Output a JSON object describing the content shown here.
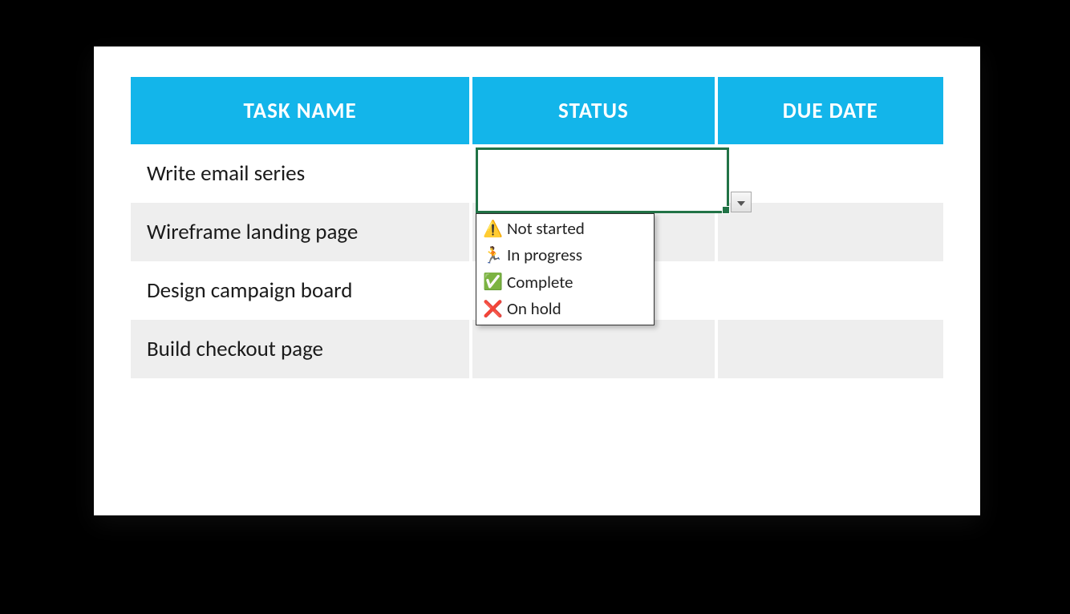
{
  "table": {
    "headers": {
      "task_name": "TASK NAME",
      "status": "STATUS",
      "due_date": "DUE DATE"
    },
    "rows": [
      {
        "task": "Write email series",
        "status": "",
        "due": ""
      },
      {
        "task": "Wireframe landing page",
        "status": "",
        "due": ""
      },
      {
        "task": "Design campaign board",
        "status": "",
        "due": ""
      },
      {
        "task": "Build checkout page",
        "status": "",
        "due": ""
      }
    ]
  },
  "dropdown": {
    "options": [
      {
        "emoji": "⚠️",
        "label": "Not started"
      },
      {
        "emoji": "🏃",
        "label": "In progress"
      },
      {
        "emoji": "✅",
        "label": "Complete"
      },
      {
        "emoji": "❌",
        "label": "On hold"
      }
    ]
  }
}
